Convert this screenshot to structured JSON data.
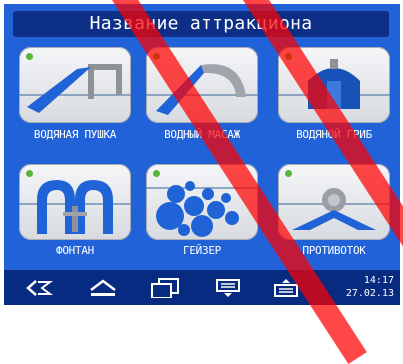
{
  "header": {
    "title": "Название аттракциона"
  },
  "tiles": [
    {
      "label": "ВОДЯНАЯ ПУШКА",
      "icon": "water-cannon-icon"
    },
    {
      "label": "ВОДНЫЙ МАСАЖ",
      "icon": "water-massage-icon"
    },
    {
      "label": "ВОДЯНОЙ ГРИБ",
      "icon": "water-mushroom-icon"
    },
    {
      "label": "ФОНТАН",
      "icon": "fountain-icon"
    },
    {
      "label": "ГЕЙЗЕР",
      "icon": "geyser-icon"
    },
    {
      "label": "ПРОТИВОТОК",
      "icon": "counterflow-icon"
    }
  ],
  "taskbar": {
    "time": "14:17",
    "date": "27.02.13"
  },
  "colors": {
    "screen": "#2262d8",
    "title_bar": "#0d2f86",
    "taskbar": "#072b80",
    "status_dot": "#58b43b",
    "watermark": "#ff0000"
  }
}
